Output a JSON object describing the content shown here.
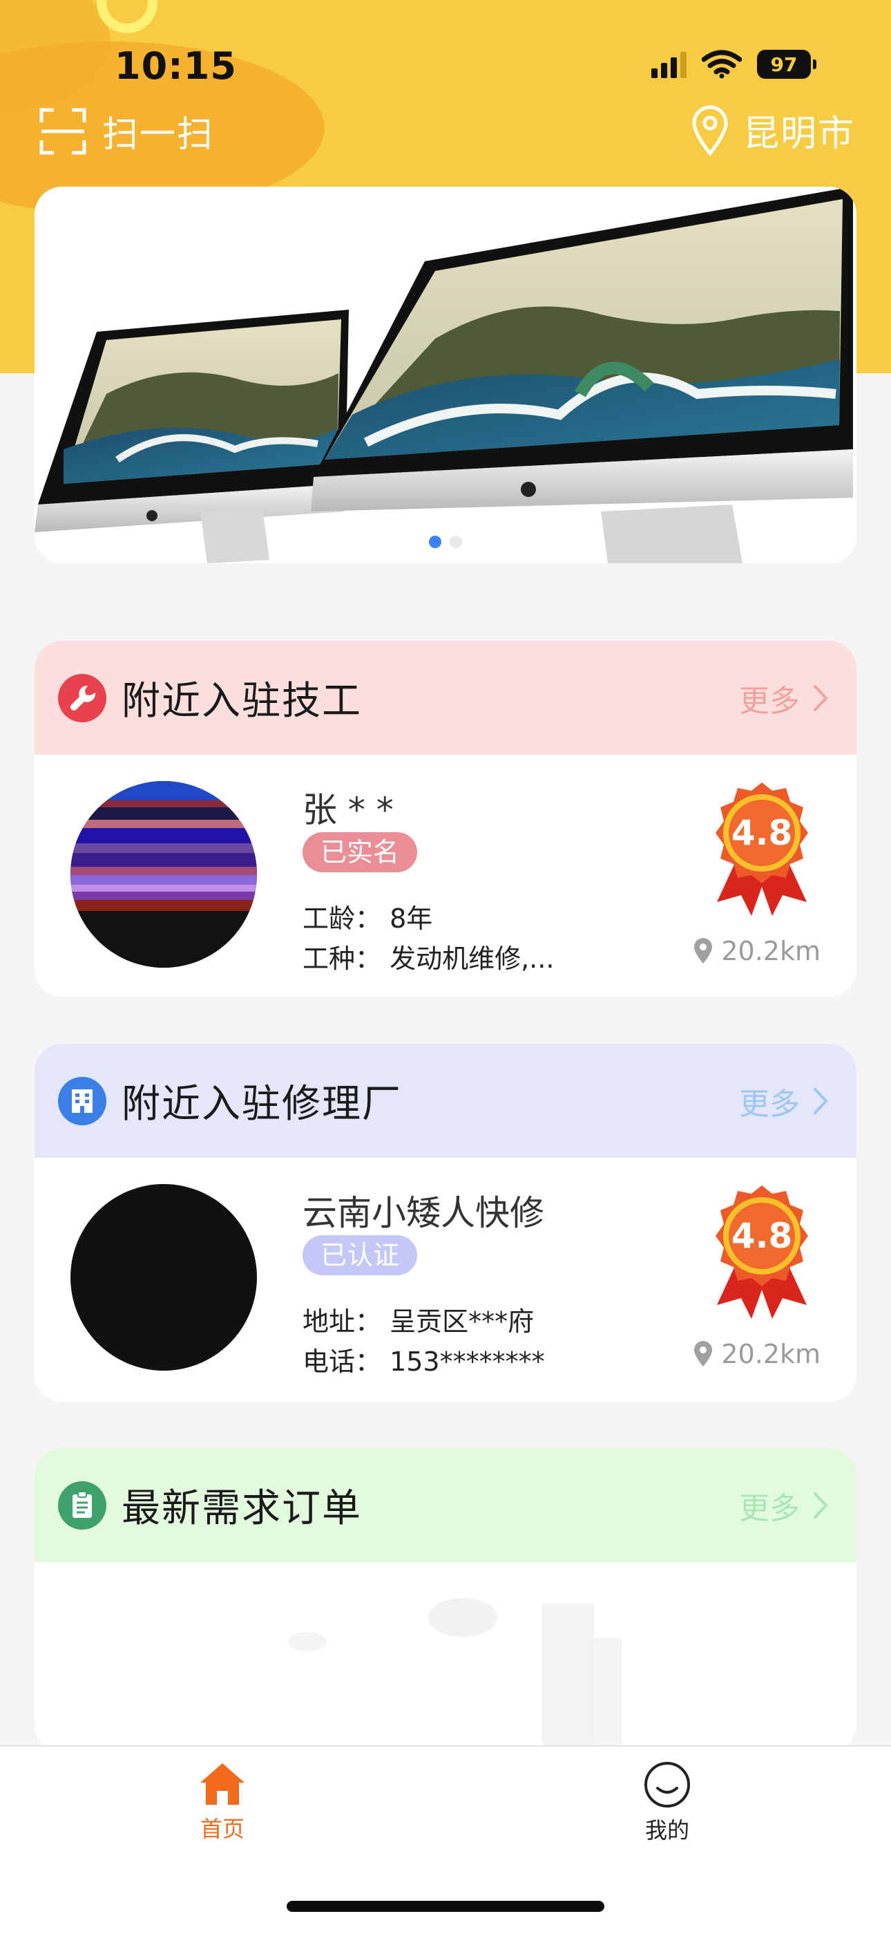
{
  "status": {
    "time": "10:15",
    "battery": "97"
  },
  "header": {
    "scan_label": "扫一扫",
    "city": "昆明市"
  },
  "banner": {
    "slides": 2,
    "active_slide": 1
  },
  "technicians": {
    "title": "附近入驻技工",
    "more_label": "更多",
    "item": {
      "name": "张 * *",
      "badge": "已实名",
      "line1": "工龄：  8年",
      "line2": "工种：  发动机维修,...",
      "rating": "4.8",
      "distance": "20.2km"
    }
  },
  "shops": {
    "title": "附近入驻修理厂",
    "more_label": "更多",
    "item": {
      "name": "云南小矮人快修",
      "badge": "已认证",
      "line1": "地址：  呈贡区***府",
      "line2": "电话：  153********",
      "rating": "4.8",
      "distance": "20.2km"
    }
  },
  "orders": {
    "title": "最新需求订单",
    "more_label": "更多"
  },
  "tabbar": {
    "home_label": "首页",
    "mine_label": "我的"
  },
  "colors": {
    "header_yellow": "#f8cc42",
    "accent_orange": "#f26b1d",
    "tech_head_bg": "#fbdfdc",
    "shop_head_bg": "#e4e6fb",
    "order_head_bg": "#e3f9dd"
  },
  "icons": {
    "scan": "scan-icon",
    "location": "location-pin-icon",
    "wrench": "wrench-icon",
    "building": "building-icon",
    "clipboard": "clipboard-icon",
    "chevron": "chevron-right-icon",
    "medal": "medal-icon",
    "home": "home-icon",
    "mine": "smile-face-icon"
  }
}
